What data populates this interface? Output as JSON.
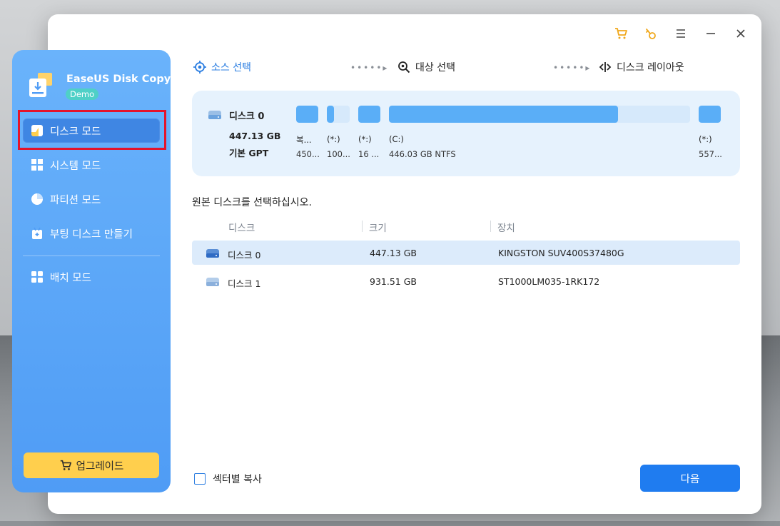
{
  "app": {
    "name": "EaseUS Disk Copy",
    "badge": "Demo",
    "accent_color": "#2a7de1"
  },
  "title_bar": {
    "icons": [
      "cart-icon",
      "key-icon",
      "menu-icon",
      "minimize-icon",
      "close-icon"
    ]
  },
  "sidebar": {
    "items": [
      {
        "label": "디스크 모드",
        "icon": "disk-mode-icon",
        "active": true
      },
      {
        "label": "시스템 모드",
        "icon": "windows-icon",
        "active": false
      },
      {
        "label": "파티션 모드",
        "icon": "pie-icon",
        "active": false
      },
      {
        "label": "부팅 디스크 만들기",
        "icon": "bootable-disk-icon",
        "active": false
      },
      {
        "label": "배치 모드",
        "icon": "grid-icon",
        "active": false
      }
    ],
    "upgrade_label": "업그레이드"
  },
  "steps": [
    {
      "label": "소스 선택",
      "icon": "target-icon",
      "state": "current"
    },
    {
      "label": "대상 선택",
      "icon": "search-target-icon",
      "state": "inactive"
    },
    {
      "label": "디스크 레이아웃",
      "icon": "layout-icon",
      "state": "inactive"
    }
  ],
  "disk_map": {
    "name": "디스크 0",
    "size": "447.13 GB",
    "type": "기본 GPT",
    "partitions": [
      {
        "label": "복...",
        "info": "450...",
        "used": 1.0
      },
      {
        "label": "(*:)",
        "info": "100...",
        "used": 0.3
      },
      {
        "label": "(*:)",
        "info": "16 ...",
        "used": 1.0
      },
      {
        "label": "(C:)",
        "info": "446.03 GB NTFS",
        "used": 0.76
      },
      {
        "label": "(*:)",
        "info": "557...",
        "used": 1.0
      }
    ]
  },
  "prompt": "원본 디스크를 선택하십시오.",
  "table": {
    "headers": [
      "디스크",
      "크기",
      "장치"
    ],
    "rows": [
      {
        "name": "디스크 0",
        "size": "447.13 GB",
        "device": "KINGSTON SUV400S37480G",
        "selected": true
      },
      {
        "name": "디스크 1",
        "size": "931.51 GB",
        "device": "ST1000LM035-1RK172",
        "selected": false
      }
    ]
  },
  "footer": {
    "sector_copy_label": "섹터별 복사",
    "sector_copy_checked": false,
    "next_label": "다음"
  }
}
